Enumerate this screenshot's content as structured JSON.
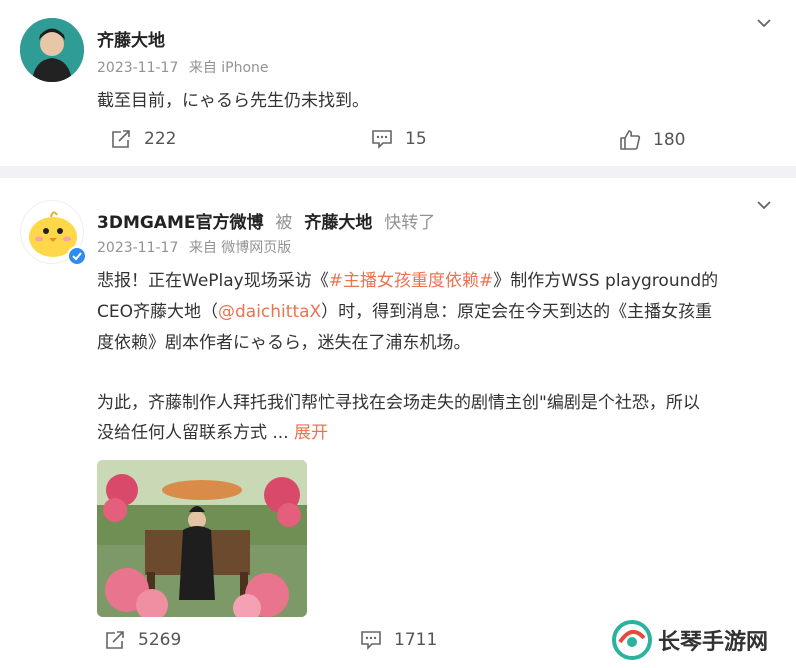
{
  "post1": {
    "author": "齐藤大地",
    "time": "2023-11-17",
    "source": "来自 iPhone",
    "text": "截至目前，にゃるら先生仍未找到。",
    "repost_count": "222",
    "comment_count": "15",
    "like_count": "180"
  },
  "post2": {
    "author": "3DMGAME官方微博",
    "via_word": "被",
    "via_author": "齐藤大地",
    "via_action": "快转了",
    "time": "2023-11-17",
    "source": "来自 微博网页版",
    "line1_a": "悲报！正在WePlay现场采访《",
    "line1_tag": "#主播女孩重度依赖#",
    "line1_b": "》制作方WSS playground的",
    "line2_a": "CEO齐藤大地（",
    "line2_mention": "@daichittaX",
    "line2_b": "）时，得到消息：原定会在今天到达的《主播女孩重",
    "line3": "度依赖》剧本作者にゃるら，迷失在了浦东机场。",
    "line4": "为此，齐藤制作人拜托我们帮忙寻找在会场走失的剧情主创\"编剧是个社恐，所以",
    "line5_a": "没给任何人留联系方式 ... ",
    "line5_more": "展开",
    "repost_count": "5269",
    "comment_count": "1711"
  },
  "watermark": {
    "text": "长琴手游网"
  },
  "icons": {
    "repost": "repost-icon",
    "comment": "comment-icon",
    "like": "like-icon",
    "chevron": "chevron-down-icon",
    "verified": "verified-badge-icon"
  },
  "colors": {
    "link": "#eb7350",
    "meta": "#939393",
    "divider": "#f1f2f5",
    "verified": "#2d8cf0"
  }
}
